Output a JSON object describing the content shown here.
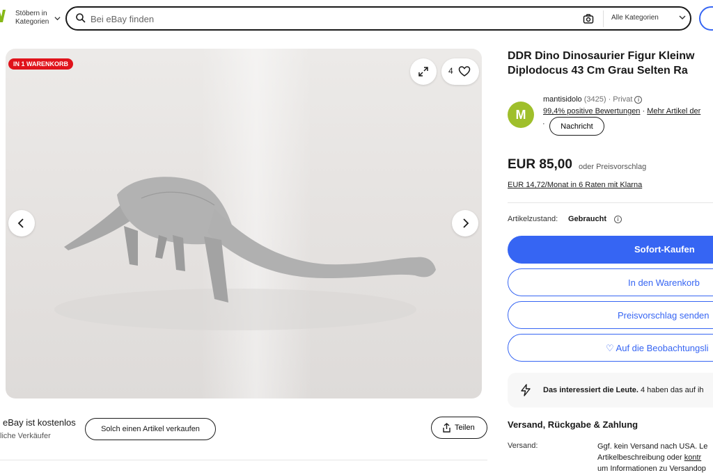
{
  "header": {
    "browse_label": "Stöbern in Kategorien",
    "search_placeholder": "Bei eBay finden",
    "category_select": "Alle Kategorien"
  },
  "gallery": {
    "badge": "IN 1 WARENKORB",
    "watch_count": "4"
  },
  "below_gallery": {
    "free_selling": "eBay ist kostenlos",
    "seller_type_fragment": "liche Verkäufer",
    "sell_button": "Solch einen Artikel verkaufen",
    "share_button": "Teilen"
  },
  "listing": {
    "title_line1": "DDR Dino Dinosaurier Figur Kleinw",
    "title_line2": "Diplodocus 43 Cm Grau Selten Ra",
    "seller": {
      "avatar_initial": "M",
      "name": "mantisidolo",
      "count": "(3425)",
      "type": "· Privat",
      "feedback": "99,4% positive Bewertungen",
      "more_items": "Mehr Artikel der",
      "message_button": "Nachricht"
    },
    "price": "EUR 85,00",
    "price_suffix": "oder Preisvorschlag",
    "installments": "EUR 14,72/Monat in 6 Raten mit Klarna",
    "condition_label": "Artikelzustand:",
    "condition_value": "Gebraucht",
    "buttons": {
      "buy_now": "Sofort-Kaufen",
      "add_to_cart": "In den Warenkorb",
      "make_offer": "Preisvorschlag senden",
      "watchlist": "♡ Auf die Beobachtungsli"
    },
    "interest": {
      "bold": "Das interessiert die Leute.",
      "rest": " 4 haben das auf ih"
    },
    "shipping": {
      "heading": "Versand, Rückgabe & Zahlung",
      "label": "Versand:",
      "line1": "Ggf. kein Versand nach USA. Le",
      "line2a": "Artikelbeschreibung oder ",
      "line2b": "kontr",
      "line3": "um Informationen zu Versandop"
    }
  },
  "colors": {
    "accent": "#3665f3",
    "badge": "#e0131b",
    "avatar": "#9fbf2b"
  }
}
